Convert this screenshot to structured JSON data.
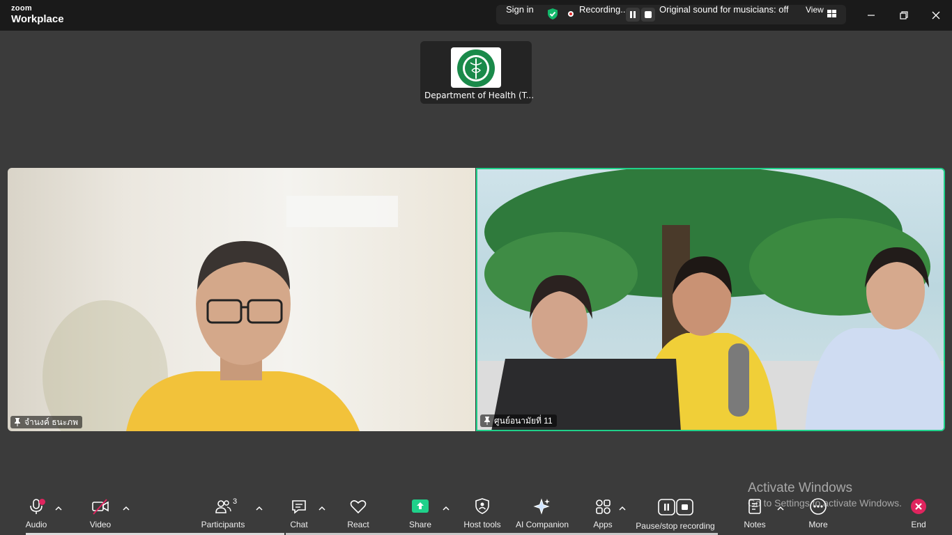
{
  "titlebar": {
    "brand_top": "zoom",
    "brand_bottom": "Workplace",
    "sign_in": "Sign in",
    "recording": "Recording...",
    "original_sound": "Original sound for musicians: off",
    "view": "View"
  },
  "thumbnail": {
    "name": "Department of Health (T..."
  },
  "videos": [
    {
      "name": "จำนงค์ ธนะภพ"
    },
    {
      "name": "ศูนย์อนามัยที่ 11"
    }
  ],
  "toolbar": {
    "audio": "Audio",
    "video": "Video",
    "participants": "Participants",
    "participants_count": "3",
    "chat": "Chat",
    "react": "React",
    "share": "Share",
    "host_tools": "Host tools",
    "ai_companion": "AI Companion",
    "apps": "Apps",
    "pause_stop_recording": "Pause/stop recording",
    "notes": "Notes",
    "more": "More",
    "end": "End"
  },
  "watermark": {
    "line1": "Activate Windows",
    "line2": "Go to Settings to activate Windows."
  },
  "colors": {
    "active_speaker_border": "#1fd18a",
    "share_green": "#1fd18a",
    "shield_green": "#12b76a",
    "end_red": "#e0245e"
  }
}
